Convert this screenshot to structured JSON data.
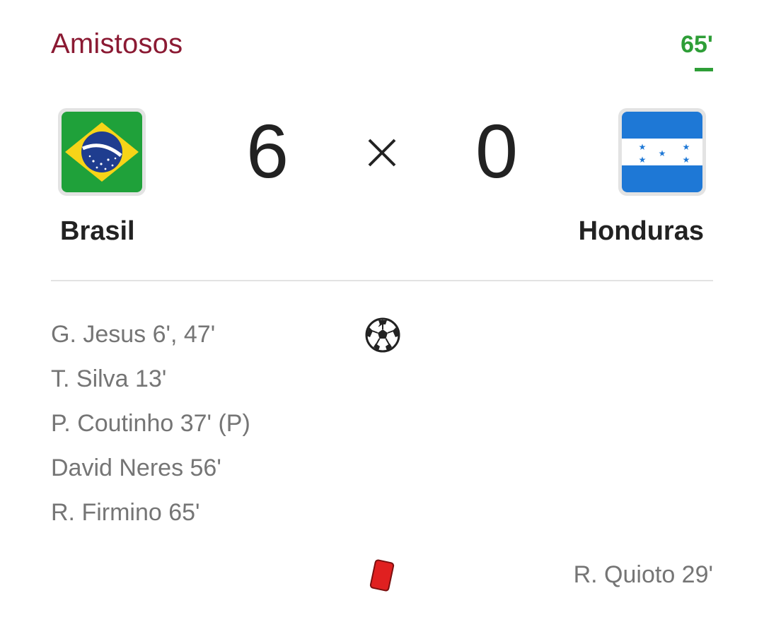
{
  "competition": "Amistosos",
  "match_minute": "65'",
  "home": {
    "name": "Brasil",
    "score": "6",
    "flag_icon": "brazil-flag-icon"
  },
  "away": {
    "name": "Honduras",
    "score": "0",
    "flag_icon": "honduras-flag-icon"
  },
  "separator": "×",
  "goals_icon": "soccer-ball-icon",
  "home_scorers": [
    "G. Jesus 6', 47'",
    "T. Silva 13'",
    "P. Coutinho 37' (P)",
    "David Neres 56'",
    "R. Firmino 65'"
  ],
  "red_cards_icon": "red-card-icon",
  "away_red_cards": [
    "R. Quioto 29'"
  ],
  "colors": {
    "competition": "#8b1a33",
    "live_minute": "#2e9e37",
    "red_card": "#e02020"
  }
}
